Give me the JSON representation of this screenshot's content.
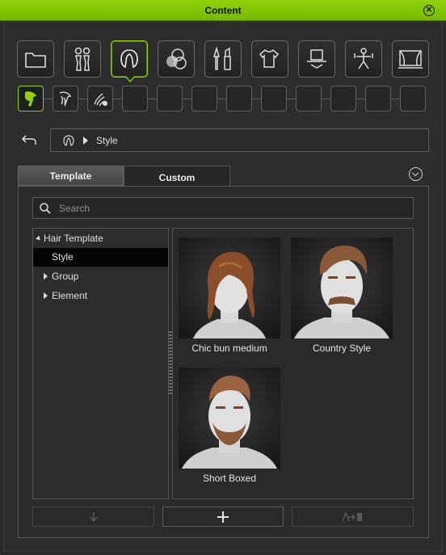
{
  "window": {
    "title": "Content"
  },
  "categories": [
    {
      "name": "folder-icon"
    },
    {
      "name": "avatar-icon"
    },
    {
      "name": "hair-icon",
      "active": true
    },
    {
      "name": "materials-icon"
    },
    {
      "name": "makeup-icon"
    },
    {
      "name": "clothing-icon"
    },
    {
      "name": "props-icon"
    },
    {
      "name": "motion-icon"
    },
    {
      "name": "stage-icon"
    }
  ],
  "subcategories": [
    {
      "name": "hair-style-icon",
      "active": true
    },
    {
      "name": "hair-builder-icon"
    },
    {
      "name": "hair-shader-icon"
    }
  ],
  "breadcrumb": {
    "label": "Style"
  },
  "tabs": [
    {
      "label": "Template",
      "active": true
    },
    {
      "label": "Custom"
    }
  ],
  "search": {
    "placeholder": "Search"
  },
  "tree": {
    "root": "Hair Template",
    "items": [
      "Style",
      "Group",
      "Element"
    ],
    "selected": "Style"
  },
  "items": [
    {
      "caption": "Chic bun medium"
    },
    {
      "caption": "Country Style"
    },
    {
      "caption": "Short Boxed"
    }
  ],
  "colors": {
    "accent": "#8fd10a",
    "titlebar": "#76b900"
  }
}
